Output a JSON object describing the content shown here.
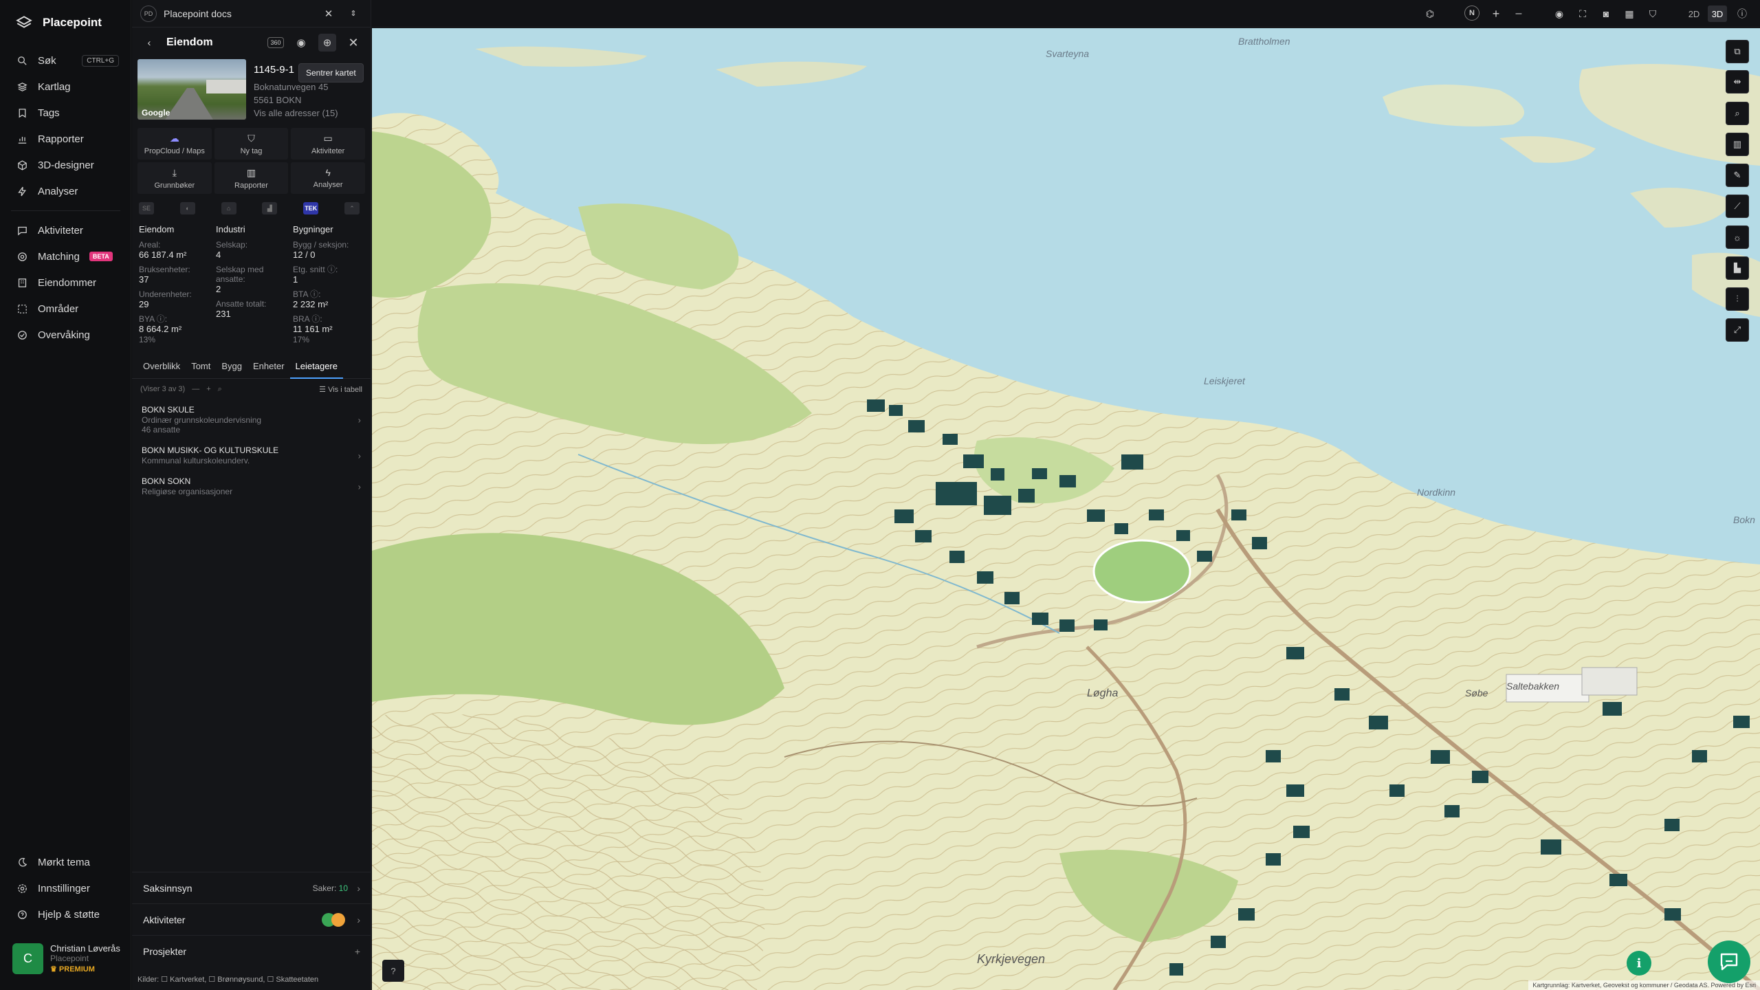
{
  "app": {
    "name": "Placepoint"
  },
  "sidebar": {
    "items": [
      {
        "label": "Søk",
        "shortcut": "CTRL+G",
        "icon": "search-icon"
      },
      {
        "label": "Kartlag",
        "icon": "layers-icon"
      },
      {
        "label": "Tags",
        "icon": "bookmark-icon"
      },
      {
        "label": "Rapporter",
        "icon": "bar-chart-icon"
      },
      {
        "label": "3D-designer",
        "icon": "cube-icon"
      },
      {
        "label": "Analyser",
        "icon": "bolt-icon"
      }
    ],
    "items2": [
      {
        "label": "Aktiviteter",
        "icon": "message-icon"
      },
      {
        "label": "Matching",
        "badge": "BETA",
        "icon": "target-icon"
      },
      {
        "label": "Eiendommer",
        "icon": "building-icon"
      },
      {
        "label": "Områder",
        "icon": "area-icon"
      },
      {
        "label": "Overvåking",
        "icon": "watch-icon"
      }
    ],
    "footer": [
      {
        "label": "Mørkt tema",
        "icon": "moon-icon"
      },
      {
        "label": "Innstillinger",
        "icon": "gear-icon"
      },
      {
        "label": "Hjelp & støtte",
        "icon": "help-icon"
      }
    ],
    "user": {
      "initial": "C",
      "name": "Christian Løverås",
      "org": "Placepoint",
      "plan": "PREMIUM"
    }
  },
  "panel": {
    "badge": "PD",
    "doc_title": "Placepoint docs",
    "header": "Eiendom",
    "tooltip": "Sentrer kartet",
    "property": {
      "id": "1145-9-1",
      "address": "Boknatunvegen 45",
      "postal": "5561 BOKN",
      "link": "Vis alle adresser (15)",
      "photo_label": "Google"
    },
    "actions": [
      {
        "label": "PropCloud / Maps",
        "icon": "cloud-icon"
      },
      {
        "label": "Ny tag",
        "icon": "bookmark-icon"
      },
      {
        "label": "Aktiviteter",
        "icon": "message-icon"
      },
      {
        "label": "Grunnbøker",
        "icon": "download-icon"
      },
      {
        "label": "Rapporter",
        "icon": "bar-chart-icon"
      },
      {
        "label": "Analyser",
        "icon": "bolt-icon"
      }
    ],
    "icon_tabs": [
      "SE",
      "◐",
      "⌂",
      "▟",
      "TEK",
      "⌃"
    ],
    "stats": {
      "eiendom": {
        "title": "Eiendom",
        "rows": [
          {
            "label": "Areal:",
            "value": "66 187.4 m²"
          },
          {
            "label": "Bruksenheter:",
            "value": "37"
          },
          {
            "label": "Underenheter:",
            "value": "29"
          },
          {
            "label": "BYA ⓘ:",
            "value": "8 664.2 m²",
            "sub": "13%"
          }
        ]
      },
      "industri": {
        "title": "Industri",
        "rows": [
          {
            "label": "Selskap:",
            "value": "4"
          },
          {
            "label": "Selskap med ansatte:",
            "value": "2"
          },
          {
            "label": "Ansatte totalt:",
            "value": "231"
          }
        ]
      },
      "bygninger": {
        "title": "Bygninger",
        "rows": [
          {
            "label": "Bygg / seksjon:",
            "value": "12 / 0"
          },
          {
            "label": "Etg. snitt ⓘ:",
            "value": "1"
          },
          {
            "label": "BTA ⓘ:",
            "value": "2 232 m²"
          },
          {
            "label": "BRA ⓘ:",
            "value": "11 161 m²",
            "sub": "17%"
          }
        ]
      }
    },
    "tabs": [
      "Overblikk",
      "Tomt",
      "Bygg",
      "Enheter",
      "Leietagere"
    ],
    "active_tab": "Leietagere",
    "list_info": "(Viser 3 av 3)",
    "list_table": "Vis i tabell",
    "tenants": [
      {
        "name": "BOKN SKULE",
        "desc": "Ordinær grunnskoleundervisning",
        "extra": "46 ansatte"
      },
      {
        "name": "BOKN MUSIKK- OG KULTURSKULE",
        "desc": "Kommunal kulturskoleunderv.",
        "extra": ""
      },
      {
        "name": "BOKN SOKN",
        "desc": "Religiøse organisasjoner",
        "extra": ""
      }
    ],
    "bottom": {
      "saksinnsyn": {
        "label": "Saksinnsyn",
        "prefix": "Saker:",
        "count": "10"
      },
      "aktiviteter": {
        "label": "Aktiviteter"
      },
      "prosjekter": {
        "label": "Prosjekter",
        "action": "+"
      }
    },
    "kilder": "Kilder: ☐ Kartverket, ☐ Brønnøysund, ☐ Skatteetaten"
  },
  "toolbar": {
    "north": "N",
    "plus": "+",
    "minus": "–",
    "mode2d": "2D",
    "mode3d": "3D",
    "active_mode": "3D"
  },
  "map": {
    "labels": [
      "Brattholmen",
      "Svarteyna",
      "Leiskjeret",
      "Nordkinn",
      "Søbe",
      "Saltebakken",
      "Løgha",
      "Kyrkjevegen",
      "Bokn"
    ],
    "attribution": "Kartgrunnlag: Kartverket, Geovekst og kommuner / Geodata AS. Powered by Esri",
    "colors": {
      "sea": "#b5dbe6",
      "land": "#e8e8c2",
      "forest": "#b9d38d",
      "building": "#1f4a4a"
    }
  }
}
